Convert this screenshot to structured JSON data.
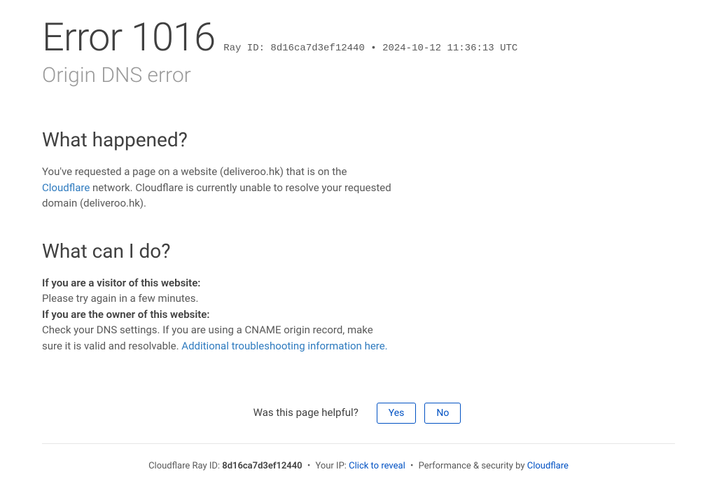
{
  "header": {
    "title": "Error 1016",
    "ray_prefix": "Ray ID: ",
    "ray_id": "8d16ca7d3ef12440",
    "bullet": " • ",
    "timestamp": "2024-10-12 11:36:13 UTC",
    "subtitle": "Origin DNS error"
  },
  "what_happened": {
    "heading": "What happened?",
    "p_before": "You've requested a page on a website (deliveroo.hk) that is on the ",
    "link_text": "Cloudflare",
    "p_after": " network. Cloudflare is currently unable to resolve your requested domain (deliveroo.hk)."
  },
  "what_can_i_do": {
    "heading": "What can I do?",
    "visitor_bold": "If you are a visitor of this website:",
    "visitor_text": "Please try again in a few minutes.",
    "owner_bold": "If you are the owner of this website:",
    "owner_text_before": "Check your DNS settings. If you are using a CNAME origin record, make sure it is valid and resolvable. ",
    "owner_link": "Additional troubleshooting information here."
  },
  "feedback": {
    "question": "Was this page helpful?",
    "yes": "Yes",
    "no": "No"
  },
  "footer": {
    "ray_label": "Cloudflare Ray ID: ",
    "ray_id": "8d16ca7d3ef12440",
    "bullet": " • ",
    "ip_label": "Your IP: ",
    "ip_reveal": "Click to reveal",
    "perf_label": "Performance & security by ",
    "cf_link": "Cloudflare"
  }
}
